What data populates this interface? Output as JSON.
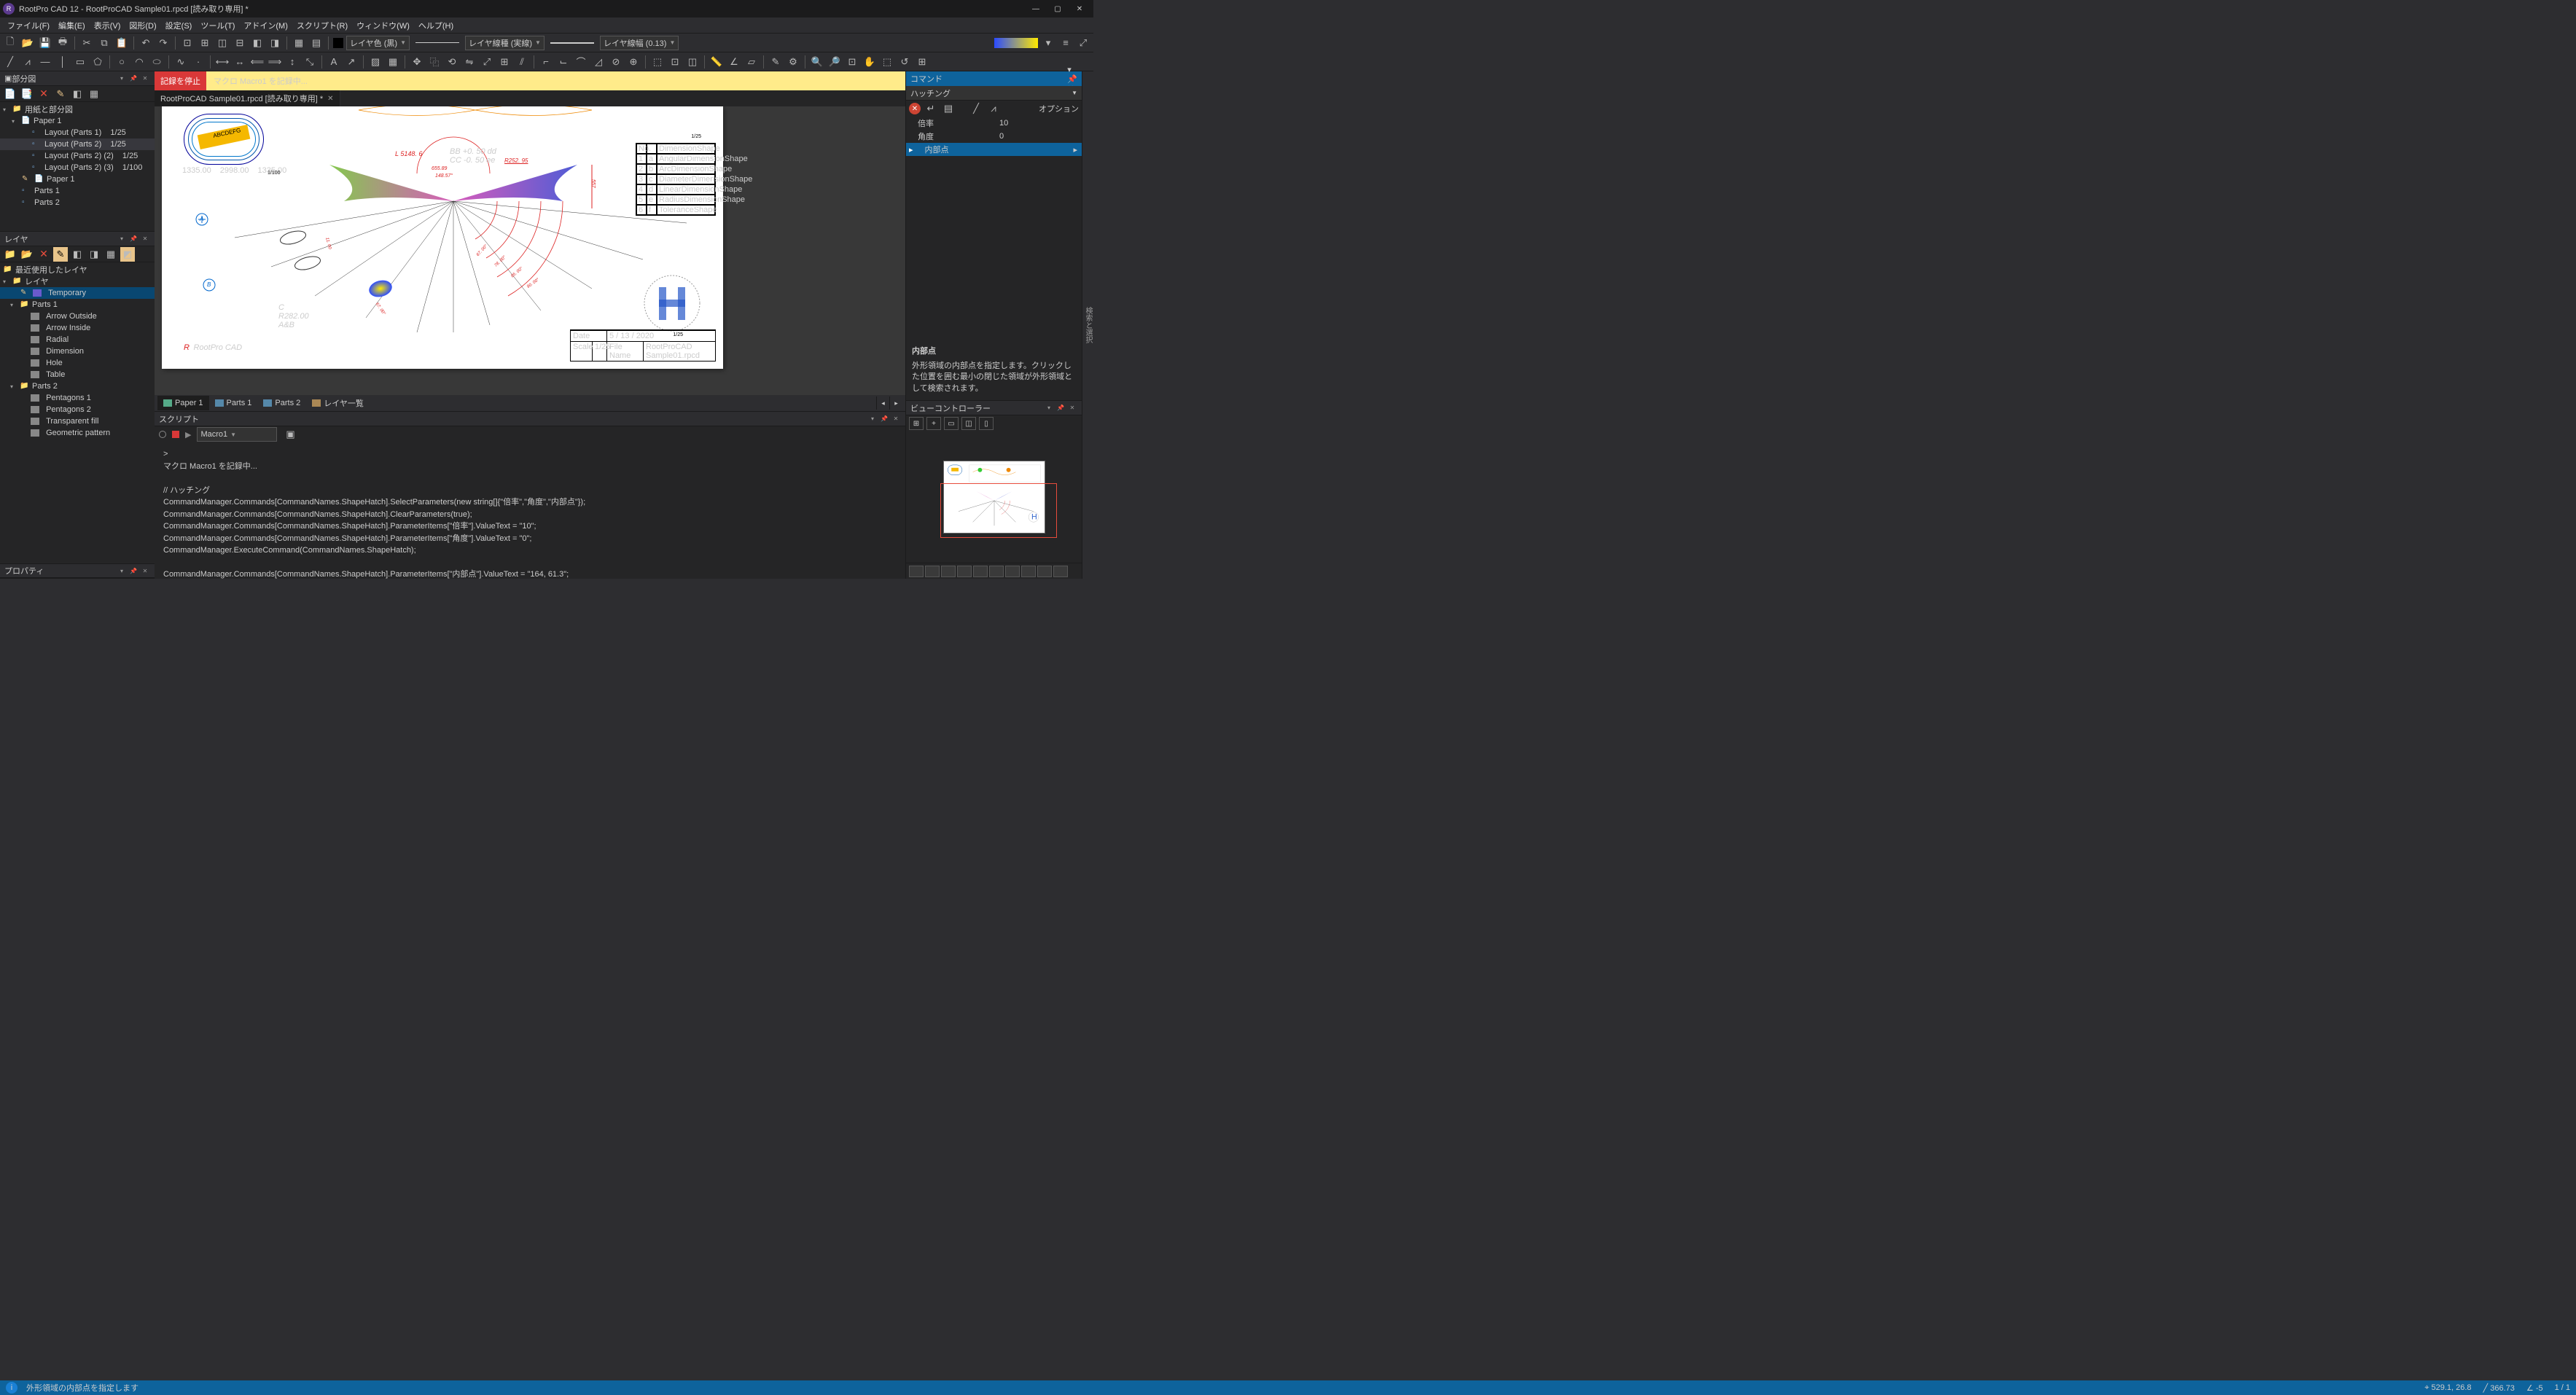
{
  "title": "RootPro CAD 12 - RootProCAD Sample01.rpcd [読み取り専用] *",
  "menus": [
    "ファイル(F)",
    "編集(E)",
    "表示(V)",
    "図形(D)",
    "設定(S)",
    "ツール(T)",
    "アドイン(M)",
    "スクリプト(R)",
    "ウィンドウ(W)",
    "ヘルプ(H)"
  ],
  "layer_color_label": "レイヤ色 (黒)",
  "layer_line_label": "レイヤ線種 (実線)",
  "layer_width_label": "レイヤ線幅 (0.13)",
  "macro": {
    "stop": "記録を停止",
    "msg": "マクロ Macro1 を記録中..."
  },
  "doc_tab": "RootProCAD Sample01.rpcd [読み取り専用] *",
  "parts_panel": {
    "title": "部分図",
    "root": "用紙と部分図",
    "paper": "Paper 1",
    "layouts": [
      {
        "name": "Layout (Parts 1)",
        "scale": "1/25"
      },
      {
        "name": "Layout (Parts 2)",
        "scale": "1/25"
      },
      {
        "name": "Layout (Parts 2) (2)",
        "scale": "1/25"
      },
      {
        "name": "Layout (Parts 2) (3)",
        "scale": "1/100"
      }
    ],
    "paper1": "Paper 1",
    "parts": [
      "Parts 1",
      "Parts 2"
    ]
  },
  "layer_panel": {
    "title": "レイヤ",
    "recent": "最近使用したレイヤ",
    "root": "レイヤ",
    "temp": "Temporary",
    "parts1": "Parts 1",
    "items": [
      "Arrow Outside",
      "Arrow Inside",
      "Radial",
      "Dimension",
      "Hole",
      "Table"
    ],
    "parts2": "Parts 2",
    "items2": [
      "Pentagons 1",
      "Pentagons 2",
      "Transparent fill",
      "Geometric pattern"
    ]
  },
  "property_panel": "プロパティ",
  "lower_tabs": [
    "Paper 1",
    "Parts 1",
    "Parts 2",
    "レイヤ一覧"
  ],
  "script": {
    "title": "スクリプト",
    "combo": "Macro1",
    "lines": [
      ">",
      "マクロ Macro1 を記録中...",
      "",
      "// ハッチング",
      "CommandManager.Commands[CommandNames.ShapeHatch].SelectParameters(new string[]{\"倍率\",\"角度\",\"内部点\"});",
      "CommandManager.Commands[CommandNames.ShapeHatch].ClearParameters(true);",
      "CommandManager.Commands[CommandNames.ShapeHatch].ParameterItems[\"倍率\"].ValueText = \"10\";",
      "CommandManager.Commands[CommandNames.ShapeHatch].ParameterItems[\"角度\"].ValueText = \"0\";",
      "CommandManager.ExecuteCommand(CommandNames.ShapeHatch);",
      "",
      "CommandManager.Commands[CommandNames.ShapeHatch].ParameterItems[\"内部点\"].ValueText = \"164, 61.3\";"
    ]
  },
  "command": {
    "title": "コマンド",
    "sub": "ハッチング",
    "opt": "オプション",
    "params": [
      {
        "k": "倍率",
        "v": "10"
      },
      {
        "k": "角度",
        "v": "0"
      },
      {
        "k": "内部点",
        "v": ""
      }
    ],
    "hint_title": "内部点",
    "hint_body": "外形領域の内部点を指定します。クリックした位置を囲む最小の閉じた領域が外形領域として検索されます。"
  },
  "viewctrl": "ビューコントローラー",
  "rbar": "検索と選択",
  "status": {
    "msg": "外形領域の内部点を指定します",
    "coord": "529.1, 26.8",
    "len": "366.73",
    "ang": "-5",
    "page": "1 / 1"
  },
  "drawing": {
    "logo": "RootPro CAD",
    "dim_main": "L 5148. 6",
    "dim_sub1": "BB +0. 50 dd",
    "dim_sub2": "CC -0. 50 ee",
    "r1": "655.89",
    "r2": "148.57°",
    "r3": "R252. 95",
    "r4": "557",
    "a": "A",
    "b": "B",
    "c": "C",
    "rc": "R282.00",
    "ab": "A&B",
    "arcs": [
      "67. 00°",
      "78. 00°",
      "85. 00°",
      "90. 00°",
      "67. 00°",
      "11. 00"
    ],
    "track_txt": "ABCDEFG",
    "track_dims": [
      "1335.00",
      "2998.00",
      "1335.00"
    ],
    "track_scale": "1/100",
    "upper_scale": "1/25",
    "h_scale": "1/25",
    "tblock": {
      "date_l": "Date",
      "date_v": "5 / 13 / 2020",
      "scale_l": "Scale",
      "scale_v": "1/25",
      "file_l": "File Name",
      "file_v": "RootProCAD Sample01.rpcd"
    },
    "dimtable": {
      "head": [
        "No.",
        "",
        "DimensionShape"
      ],
      "rows": [
        [
          "1",
          "a",
          "AngularDimensionShape"
        ],
        [
          "2",
          "b",
          "ArcDimensionShape"
        ],
        [
          "3",
          "c",
          "DiameterDimensionShape"
        ],
        [
          "4",
          "d",
          "LinearDimensionShape"
        ],
        [
          "5",
          "e",
          "RadiusDimensionShape"
        ],
        [
          "6",
          "f",
          "ToleranceShape"
        ]
      ]
    }
  }
}
